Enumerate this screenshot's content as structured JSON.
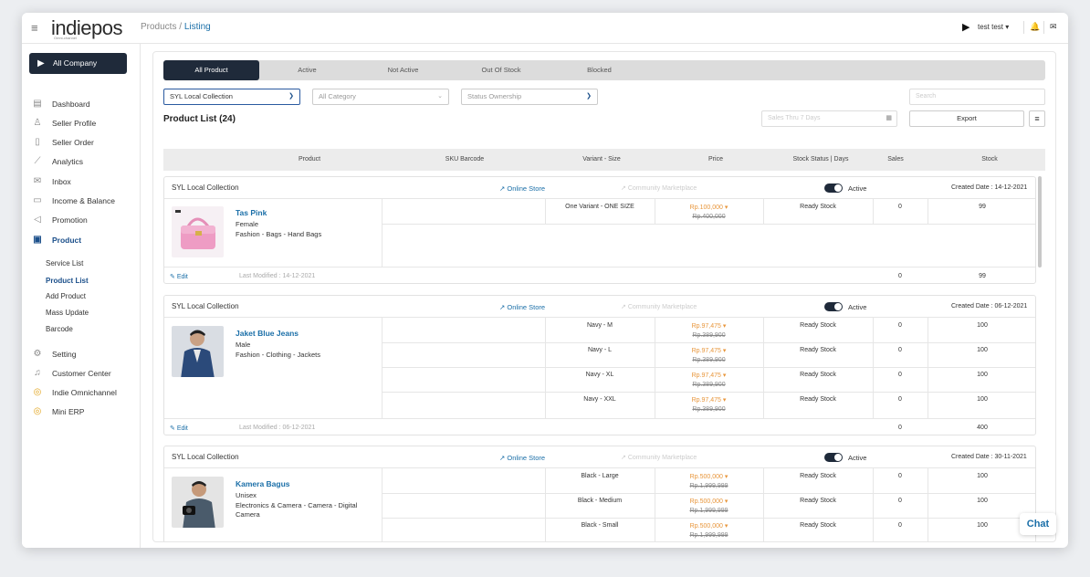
{
  "header": {
    "logo": "indiepos",
    "logo_sub": "Omni-channel",
    "breadcrumb_root": "Products",
    "breadcrumb_sep": " / ",
    "breadcrumb_current": "Listing",
    "user": "test test"
  },
  "sidebar": {
    "company": "All Company",
    "items": [
      {
        "label": "Dashboard",
        "icon": "dashboard-icon"
      },
      {
        "label": "Seller Profile",
        "icon": "user-icon"
      },
      {
        "label": "Seller Order",
        "icon": "order-icon"
      },
      {
        "label": "Analytics",
        "icon": "analytics-icon"
      },
      {
        "label": "Inbox",
        "icon": "inbox-icon"
      },
      {
        "label": "Income & Balance",
        "icon": "wallet-icon"
      },
      {
        "label": "Promotion",
        "icon": "megaphone-icon"
      },
      {
        "label": "Product",
        "icon": "product-icon"
      }
    ],
    "sub_items": [
      "Service List",
      "Product List",
      "Add Product",
      "Mass Update",
      "Barcode"
    ],
    "items2": [
      {
        "label": "Setting",
        "icon": "gear-icon"
      },
      {
        "label": "Customer Center",
        "icon": "headset-icon"
      },
      {
        "label": "Indie Omnichannel",
        "icon": "omnichannel-icon"
      },
      {
        "label": "Mini ERP",
        "icon": "erp-icon"
      }
    ]
  },
  "tabs": [
    "All Product",
    "Active",
    "Not Active",
    "Out Of Stock",
    "Blocked"
  ],
  "filters": {
    "collection": "SYL Local Collection",
    "category": "All Category",
    "ownership": "Status Ownership",
    "search_placeholder": "Search",
    "sales_placeholder": "Sales Thru 7 Days",
    "export": "Export"
  },
  "list_title": "Product List (24)",
  "columns": [
    "Product",
    "SKU Barcode",
    "Variant - Size",
    "Price",
    "Stock Status | Days",
    "Sales",
    "Stock"
  ],
  "labels": {
    "online_store": "Online Store",
    "community": "Community Marketplace",
    "active": "Active",
    "edit": "Edit"
  },
  "products": [
    {
      "store": "SYL Local Collection",
      "created": "Created Date : 14-12-2021",
      "name": "Tas Pink",
      "gender": "Female",
      "category": "Fashion - Bags - Hand Bags",
      "variants": [
        {
          "size": "One Variant - ONE SIZE",
          "price": "Rp.100,000 ▾",
          "old": "Rp.400,000",
          "status": "Ready Stock",
          "sales": "0",
          "stock": "99"
        }
      ],
      "modified": "Last Modified : 14-12-2021",
      "total_sales": "0",
      "total_stock": "99"
    },
    {
      "store": "SYL Local Collection",
      "created": "Created Date : 06-12-2021",
      "name": "Jaket Blue Jeans",
      "gender": "Male",
      "category": "Fashion - Clothing - Jackets",
      "variants": [
        {
          "size": "Navy - M",
          "price": "Rp.97,475 ▾",
          "old": "Rp.389,900",
          "status": "Ready Stock",
          "sales": "0",
          "stock": "100"
        },
        {
          "size": "Navy - L",
          "price": "Rp.97,475 ▾",
          "old": "Rp.389,900",
          "status": "Ready Stock",
          "sales": "0",
          "stock": "100"
        },
        {
          "size": "Navy - XL",
          "price": "Rp.97,475 ▾",
          "old": "Rp.389,900",
          "status": "Ready Stock",
          "sales": "0",
          "stock": "100"
        },
        {
          "size": "Navy - XXL",
          "price": "Rp.97,475 ▾",
          "old": "Rp.389,900",
          "status": "Ready Stock",
          "sales": "0",
          "stock": "100"
        }
      ],
      "modified": "Last Modified : 06-12-2021",
      "total_sales": "0",
      "total_stock": "400"
    },
    {
      "store": "SYL Local Collection",
      "created": "Created Date : 30-11-2021",
      "name": "Kamera Bagus",
      "gender": "Unisex",
      "category": "Electronics & Camera - Camera - Digital Camera",
      "variants": [
        {
          "size": "Black - Large",
          "price": "Rp.500,000 ▾",
          "old": "Rp.1,999,999",
          "status": "Ready Stock",
          "sales": "0",
          "stock": "100"
        },
        {
          "size": "Black - Medium",
          "price": "Rp.500,000 ▾",
          "old": "Rp.1,999,999",
          "status": "Ready Stock",
          "sales": "0",
          "stock": "100"
        },
        {
          "size": "Black - Small",
          "price": "Rp.500,000 ▾",
          "old": "Rp.1,999,999",
          "status": "Ready Stock",
          "sales": "0",
          "stock": "100"
        }
      ],
      "modified": "",
      "total_sales": "",
      "total_stock": ""
    }
  ],
  "chat": "Chat"
}
